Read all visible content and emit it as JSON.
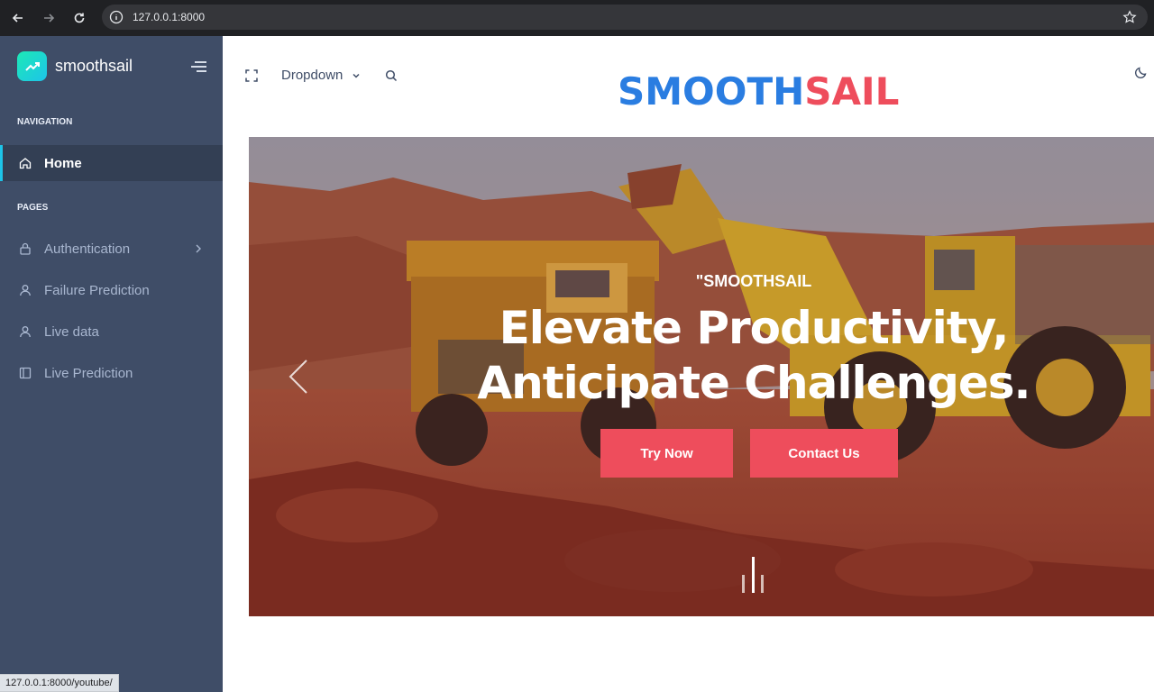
{
  "browser": {
    "url": "127.0.0.1:8000"
  },
  "sidebar": {
    "brand": "smoothsail",
    "navigation_caption": "NAVIGATION",
    "pages_caption": "PAGES",
    "items": [
      {
        "label": "Home",
        "icon": "home-icon",
        "active": true
      },
      {
        "label": "Authentication",
        "icon": "lock-icon",
        "has_submenu": true
      },
      {
        "label": "Failure Prediction",
        "icon": "user-icon"
      },
      {
        "label": "Live data",
        "icon": "user-icon"
      },
      {
        "label": "Live Prediction",
        "icon": "sidebar-layout-icon"
      }
    ]
  },
  "status_bar": {
    "hover_url": "127.0.0.1:8000/youtube/"
  },
  "header": {
    "dropdown_label": "Dropdown",
    "logo_part1": "SMOOTH",
    "logo_part2": "SAIL"
  },
  "hero": {
    "kicker": "\"SMOOTHSAIL",
    "title": "Elevate Productivity, Anticipate Challenges.",
    "try_now": "Try Now",
    "contact_us": "Contact Us"
  },
  "colors": {
    "sidebar_bg": "#3f4d67",
    "accent": "#ee4d5c",
    "logo_blue": "#2a7de1",
    "brand_gradient": "#1de9b6"
  }
}
